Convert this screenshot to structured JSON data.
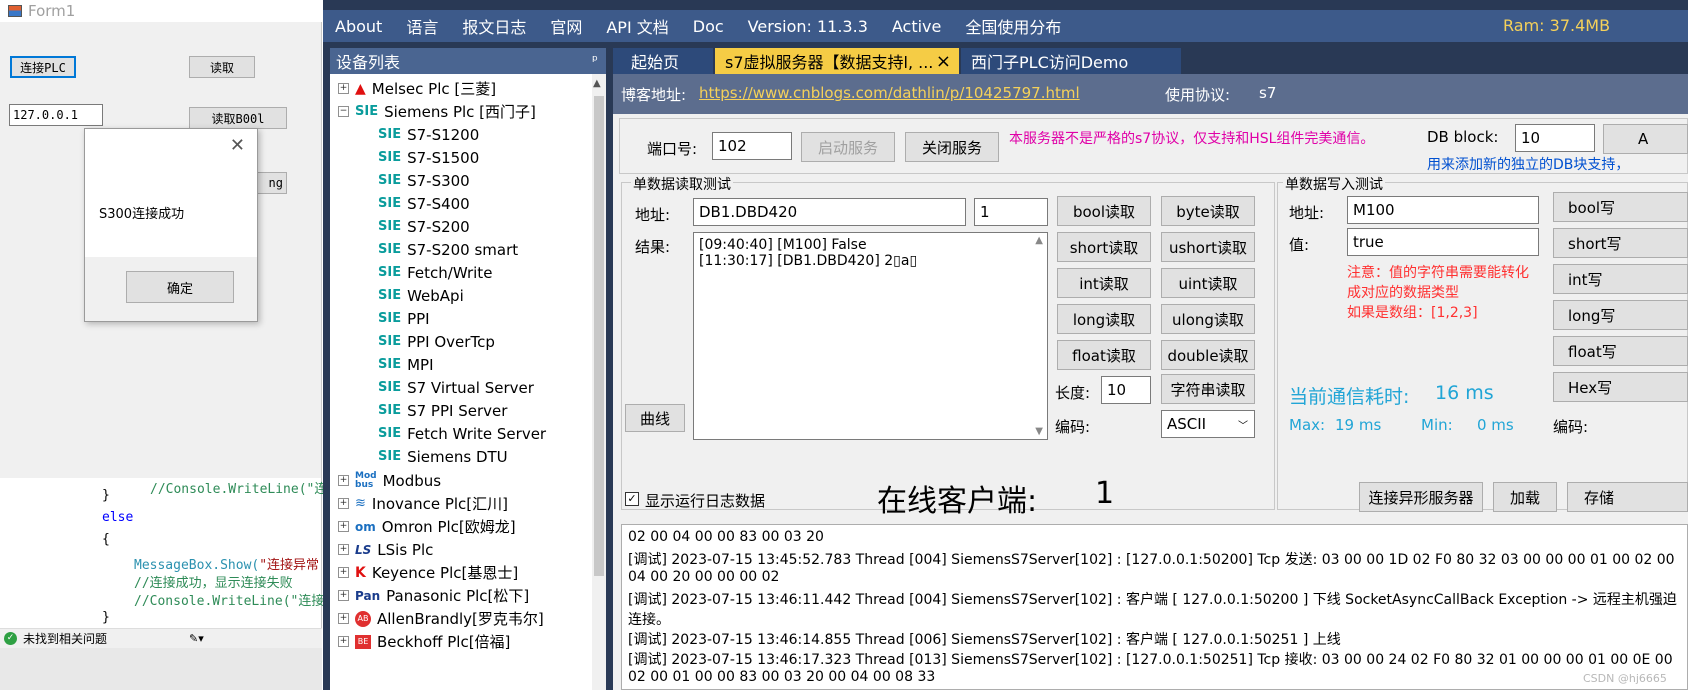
{
  "form1": {
    "title": "Form1",
    "connect_button": "连接PLC",
    "read_button": "读取",
    "ip_value": "127.0.0.1",
    "read_bool_button": "读取B00l",
    "partial_button": "ng"
  },
  "message_box": {
    "text": "S300连接成功",
    "ok_button": "确定"
  },
  "code": {
    "line1": "//Console.WriteLine(\"连接",
    "line2": "}",
    "line3": "else",
    "line4": "{",
    "line5_method": "MessageBox.Show(",
    "line5_str": "\"连接异常",
    "line6": "//连接成功，显示连接失败",
    "line7": "//Console.WriteLine(\"连接",
    "line8": "}"
  },
  "status_bar": {
    "text": "未找到相关问题"
  },
  "menu": [
    "About",
    "语言",
    "报文日志",
    "官网",
    "API 文档",
    "Doc",
    "Version: 11.3.3",
    "Active",
    "全国使用分布"
  ],
  "ram": "Ram: 37.4MB",
  "device_list": {
    "header": "设备列表",
    "pin": "ᵖ",
    "items": [
      {
        "label": "Melsec Plc [三菱]",
        "icon": "mitsubishi-icon",
        "level": 0
      },
      {
        "label": "Siemens Plc [西门子]",
        "icon": "siemens-icon",
        "level": 0
      },
      {
        "label": "S7-S1200",
        "icon": "siemens-icon",
        "level": 1
      },
      {
        "label": "S7-S1500",
        "icon": "siemens-icon",
        "level": 1
      },
      {
        "label": "S7-S300",
        "icon": "siemens-icon",
        "level": 1
      },
      {
        "label": "S7-S400",
        "icon": "siemens-icon",
        "level": 1
      },
      {
        "label": "S7-S200",
        "icon": "siemens-icon",
        "level": 1
      },
      {
        "label": "S7-S200 smart",
        "icon": "siemens-icon",
        "level": 1
      },
      {
        "label": "Fetch/Write",
        "icon": "siemens-icon",
        "level": 1
      },
      {
        "label": "WebApi",
        "icon": "siemens-icon",
        "level": 1
      },
      {
        "label": "PPI",
        "icon": "siemens-icon",
        "level": 1
      },
      {
        "label": "PPI OverTcp",
        "icon": "siemens-icon",
        "level": 1
      },
      {
        "label": "MPI",
        "icon": "siemens-icon",
        "level": 1
      },
      {
        "label": "S7 Virtual Server",
        "icon": "siemens-icon",
        "level": 1
      },
      {
        "label": "S7 PPI Server",
        "icon": "siemens-icon",
        "level": 1
      },
      {
        "label": "Fetch Write Server",
        "icon": "siemens-icon",
        "level": 1
      },
      {
        "label": "Siemens DTU",
        "icon": "siemens-icon",
        "level": 1
      },
      {
        "label": "Modbus",
        "icon": "modbus-icon",
        "level": 0
      },
      {
        "label": "Inovance Plc[汇川]",
        "icon": "inovance-icon",
        "level": 0
      },
      {
        "label": "Omron Plc[欧姆龙]",
        "icon": "omron-icon",
        "level": 0
      },
      {
        "label": "LSis Plc",
        "icon": "ls-icon",
        "level": 0
      },
      {
        "label": "Keyence Plc[基恩士]",
        "icon": "keyence-icon",
        "level": 0
      },
      {
        "label": "Panasonic Plc[松下]",
        "icon": "panasonic-icon",
        "level": 0
      },
      {
        "label": "AllenBrandly[罗克韦尔]",
        "icon": "allenbradley-icon",
        "level": 0
      },
      {
        "label": "Beckhoff Plc[倍福]",
        "icon": "beckhoff-icon",
        "level": 0
      }
    ]
  },
  "tabs": [
    {
      "label": "起始页"
    },
    {
      "label": "s7虚拟服务器【数据支持l, ...",
      "close": "×"
    },
    {
      "label": "西门子PLC访问Demo"
    }
  ],
  "blog": {
    "label": "博客地址:",
    "url": "https://www.cnblogs.com/dathlin/p/10425797.html",
    "protocol_label": "使用协议:",
    "protocol_value": "s7"
  },
  "server": {
    "port_label": "端口号:",
    "port_value": "102",
    "start_button": "启动服务",
    "stop_button": "关闭服务",
    "notice": "本服务器不是严格的s7协议，仅支持和HSL组件完美通信。",
    "db_label": "DB block:",
    "db_value": "10",
    "db_hint": "用来添加新的独立的DB块支持，",
    "partial_button": "A"
  },
  "read_group": {
    "title": "单数据读取测试",
    "address_label": "地址:",
    "address_value": "DB1.DBD420",
    "count_value": "1",
    "result_label": "结果:",
    "result_lines": [
      "[09:40:40] [M100] False",
      "[11:30:17] [DB1.DBD420] 2▯a▯"
    ],
    "curve_button": "曲线",
    "buttons": [
      "bool读取",
      "byte读取",
      "short读取",
      "ushort读取",
      "int读取",
      "uint读取",
      "long读取",
      "ulong读取",
      "float读取",
      "double读取"
    ],
    "length_label": "长度:",
    "length_value": "10",
    "string_read_button": "字符串读取",
    "encoding_label": "编码:",
    "encoding_value": "ASCII"
  },
  "write_group": {
    "title": "单数据写入测试",
    "address_label": "地址:",
    "address_value": "M100",
    "value_label": "值:",
    "value_value": "true",
    "note_lines": [
      "注意：值的字符串需要能转化",
      "成对应的数据类型",
      "如果是数组：[1,2,3]"
    ],
    "buttons": [
      "bool写",
      "short写",
      "int写",
      "long写",
      "float写",
      "Hex写"
    ],
    "encoding_label": "编码:"
  },
  "stats": {
    "time_label": "当前通信耗时:",
    "time_value": "16 ms",
    "max_label": "Max:",
    "max_value": "19 ms",
    "min_label": "Min:",
    "min_value": "0 ms"
  },
  "log_options": {
    "checkbox_label": "显示运行日志数据",
    "online_label": "在线客户端:",
    "online_count": "1",
    "connect_alien_button": "连接异形服务器",
    "load_button": "加载",
    "save_button": "存储"
  },
  "log_lines": [
    "02 00 04 00 00 83 00 03 20",
    "[调试] 2023-07-15 13:45:52.783 Thread [004] SiemensS7Server[102] : [127.0.0.1:50200] Tcp 发送: 03 00 00 1D 02 F0 80 32 03 00 00 00 01 00 02 00",
    "04 00 20 00 00 00 02",
    "[调试] 2023-07-15 13:46:11.442 Thread [004] SiemensS7Server[102] : 客户端 [ 127.0.0.1:50200 ] 下线 SocketAsyncCallBack Exception -> 远程主机强迫",
    "连接。",
    "[调试] 2023-07-15 13:46:14.855 Thread [006] SiemensS7Server[102] : 客户端 [ 127.0.0.1:50251 ] 上线",
    "[调试] 2023-07-15 13:46:17.323 Thread [013] SiemensS7Server[102] : [127.0.0.1:50251] Tcp 接收: 03 00 00 24 02 F0 80 32 01 00 00 00 01 00 0E 00",
    "02 00 01 00 00 83 00 03 20 00 04 00 08 33"
  ],
  "watermark": "CSDN @hj6665",
  "colors": {
    "menu": "#3d5a8a",
    "panel_header": "#4a6591",
    "active_tab": "#f5cc45",
    "link": "#0000ee",
    "notice": "#e000a8",
    "hint": "#0050d0",
    "stats": "#21a5d6",
    "note_red": "#ff3030"
  }
}
